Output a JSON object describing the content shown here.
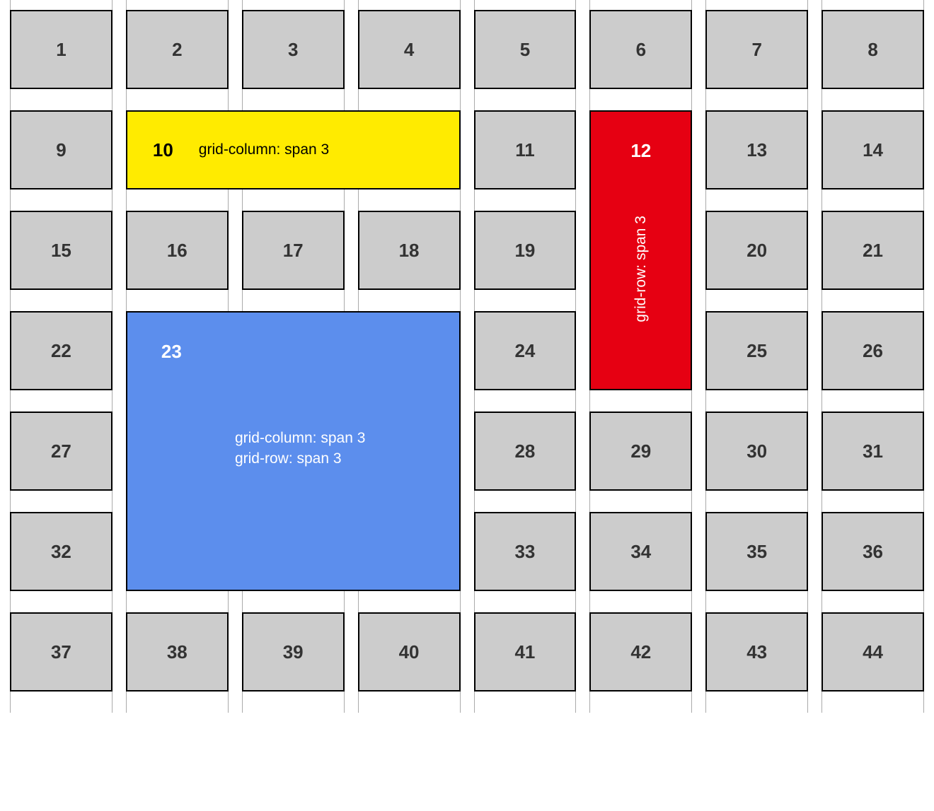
{
  "grid": {
    "columns": 8,
    "tiles": [
      {
        "num": "1"
      },
      {
        "num": "2"
      },
      {
        "num": "3"
      },
      {
        "num": "4"
      },
      {
        "num": "5"
      },
      {
        "num": "6"
      },
      {
        "num": "7"
      },
      {
        "num": "8"
      },
      {
        "num": "9"
      },
      {
        "num": "10",
        "variant": "yellow",
        "caption": "grid-column: span 3"
      },
      {
        "num": "11"
      },
      {
        "num": "12",
        "variant": "red",
        "caption": "grid-row: span 3"
      },
      {
        "num": "13"
      },
      {
        "num": "14"
      },
      {
        "num": "15"
      },
      {
        "num": "16"
      },
      {
        "num": "17"
      },
      {
        "num": "18"
      },
      {
        "num": "19"
      },
      {
        "num": "20"
      },
      {
        "num": "21"
      },
      {
        "num": "22"
      },
      {
        "num": "23",
        "variant": "blue",
        "caption": "grid-column: span 3\ngrid-row: span 3"
      },
      {
        "num": "24"
      },
      {
        "num": "25"
      },
      {
        "num": "26"
      },
      {
        "num": "27"
      },
      {
        "num": "28"
      },
      {
        "num": "29"
      },
      {
        "num": "30"
      },
      {
        "num": "31"
      },
      {
        "num": "32"
      },
      {
        "num": "33"
      },
      {
        "num": "34"
      },
      {
        "num": "35"
      },
      {
        "num": "36"
      },
      {
        "num": "37"
      },
      {
        "num": "38"
      },
      {
        "num": "39"
      },
      {
        "num": "40"
      },
      {
        "num": "41"
      },
      {
        "num": "42"
      },
      {
        "num": "43"
      },
      {
        "num": "44"
      }
    ]
  }
}
